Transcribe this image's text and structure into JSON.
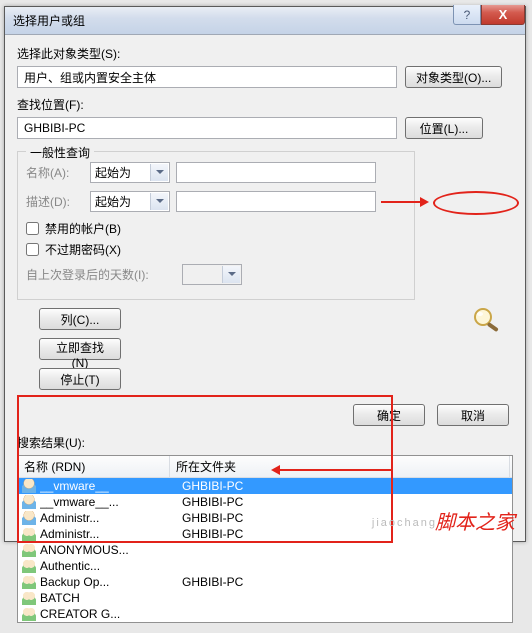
{
  "title": "选择用户或组",
  "section": {
    "object_type_label": "选择此对象类型(S):",
    "object_type_value": "用户、组或内置安全主体",
    "btn_object_types": "对象类型(O)...",
    "location_label": "查找位置(F):",
    "location_value": "GHBIBI-PC",
    "btn_location": "位置(L)..."
  },
  "query": {
    "legend": "一般性查询",
    "name_label": "名称(A):",
    "name_combo": "起始为",
    "desc_label": "描述(D):",
    "desc_combo": "起始为",
    "cb_disabled": "禁用的帐户(B)",
    "cb_noexpire": "不过期密码(X)",
    "lastlogin_label": "自上次登录后的天数(I):"
  },
  "sidebtns": {
    "columns": "列(C)...",
    "find_now": "立即查找(N)",
    "stop": "停止(T)"
  },
  "okrow": {
    "ok": "确定",
    "cancel": "取消"
  },
  "results": {
    "label": "搜索结果(U):",
    "cols": {
      "c1": "名称 (RDN)",
      "c2": "所在文件夹"
    },
    "rows": [
      {
        "t": "user",
        "n": "__vmware__",
        "f": "GHBIBI-PC",
        "sel": true
      },
      {
        "t": "user",
        "n": "__vmware__...",
        "f": "GHBIBI-PC"
      },
      {
        "t": "user",
        "n": "Administr...",
        "f": "GHBIBI-PC"
      },
      {
        "t": "grp",
        "n": "Administr...",
        "f": "GHBIBI-PC"
      },
      {
        "t": "grp",
        "n": "ANONYMOUS...",
        "f": ""
      },
      {
        "t": "grp",
        "n": "Authentic...",
        "f": ""
      },
      {
        "t": "grp",
        "n": "Backup Op...",
        "f": "GHBIBI-PC"
      },
      {
        "t": "grp",
        "n": "BATCH",
        "f": ""
      },
      {
        "t": "grp",
        "n": "CREATOR G...",
        "f": ""
      }
    ]
  },
  "watermark": "脚本之家",
  "watermark_url": "jiaochang"
}
